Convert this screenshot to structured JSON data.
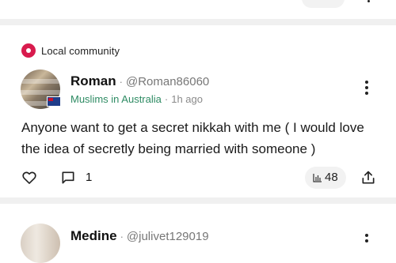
{
  "post1": {
    "badge": "Local community",
    "author": {
      "name": "Roman",
      "handle": "@Roman86060"
    },
    "community": "Muslims in Australia",
    "time": "1h ago",
    "text": "Anyone want to get a secret nikkah with me ( I would love the idea of secretly being married with someone )",
    "comments": "1",
    "views": "48"
  },
  "post2": {
    "author": {
      "name": "Medine",
      "handle": "@julivet129019"
    }
  },
  "separator": "·",
  "colors": {
    "badge_pin": "#d81b4d",
    "community": "#2e8b63",
    "divider": "#f0f0f0"
  },
  "icons": [
    "location-pin-icon",
    "heart-icon",
    "comment-icon",
    "views-chart-icon",
    "share-icon",
    "more-options-icon",
    "flag-icon"
  ]
}
